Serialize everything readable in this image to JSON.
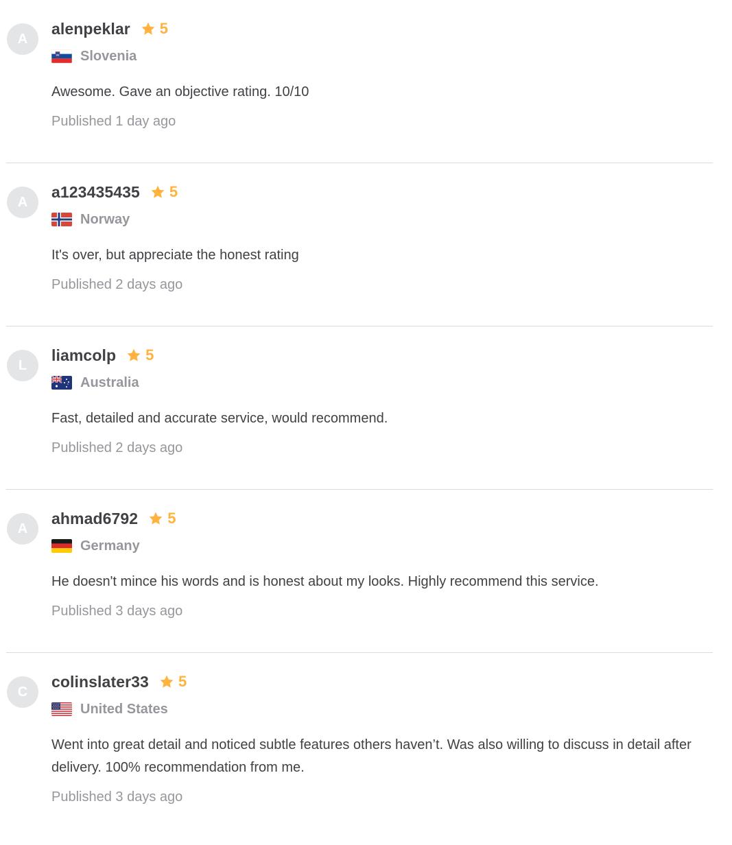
{
  "reviews": [
    {
      "initial": "A",
      "username": "alenpeklar",
      "rating": "5",
      "flag": "slovenia-flag",
      "country": "Slovenia",
      "text": "Awesome. Gave an objective rating. 10/10",
      "published": "Published 1 day ago"
    },
    {
      "initial": "A",
      "username": "a123435435",
      "rating": "5",
      "flag": "norway-flag",
      "country": "Norway",
      "text": "It's over, but appreciate the honest rating",
      "published": "Published 2 days ago"
    },
    {
      "initial": "L",
      "username": "liamcolp",
      "rating": "5",
      "flag": "australia-flag",
      "country": "Australia",
      "text": "Fast, detailed and accurate service, would recommend.",
      "published": "Published 2 days ago"
    },
    {
      "initial": "A",
      "username": "ahmad6792",
      "rating": "5",
      "flag": "germany-flag",
      "country": "Germany",
      "text": "He doesn't mince his words and is honest about my looks. Highly recommend this service.",
      "published": "Published 3 days ago"
    },
    {
      "initial": "C",
      "username": "colinslater33",
      "rating": "5",
      "flag": "united-states-flag",
      "country": "United States",
      "text": "Went into great detail and noticed subtle features others haven’t. Was also willing to discuss in detail after delivery. 100% recommendation from me.",
      "published": "Published 3 days ago"
    }
  ],
  "colors": {
    "star": "#ffb33e",
    "text": "#404145",
    "muted": "#95979d",
    "divider": "#dadbdd",
    "avatar_bg": "#e4e5e7"
  }
}
